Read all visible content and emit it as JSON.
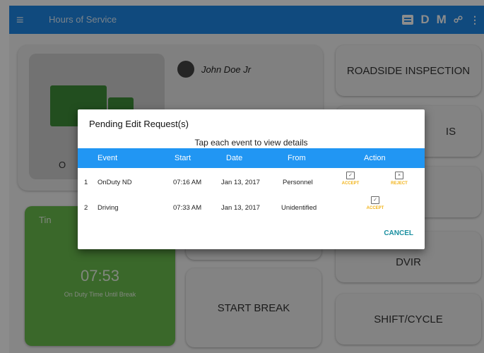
{
  "appbar": {
    "title": "Hours of Service",
    "letters": [
      "D",
      "M"
    ]
  },
  "background": {
    "driver_name": "John Doe Jr",
    "tile_left_partial": "O",
    "timer_partial": "Tin",
    "timer_value": "07:53",
    "timer_caption": "On Duty Time Until Break",
    "buttons": {
      "roadside": "ROADSIDE INSPECTION",
      "right2_partial": "IS",
      "dvir": "DVIR",
      "start_break": "START BREAK",
      "shift_cycle": "SHIFT/CYCLE"
    }
  },
  "dialog": {
    "title": "Pending Edit Request(s)",
    "subtitle": "Tap each event to view details",
    "columns": [
      "Event",
      "Start",
      "Date",
      "From",
      "Action"
    ],
    "rows": [
      {
        "index": "1",
        "event": "OnDuty ND",
        "start": "07:16 AM",
        "date": "Jan 13, 2017",
        "from": "Personnel",
        "accept": "ACCEPT",
        "reject": "REJECT"
      },
      {
        "index": "2",
        "event": "Driving",
        "start": "07:33 AM",
        "date": "Jan 13, 2017",
        "from": "Unidentified",
        "accept": "ACCEPT"
      }
    ],
    "cancel": "CANCEL"
  },
  "colors": {
    "appbar": "#1e88e5",
    "header": "#2196f3",
    "accent": "#f2b318",
    "green": "#5aa53e",
    "cancel": "#1a8fa0"
  }
}
